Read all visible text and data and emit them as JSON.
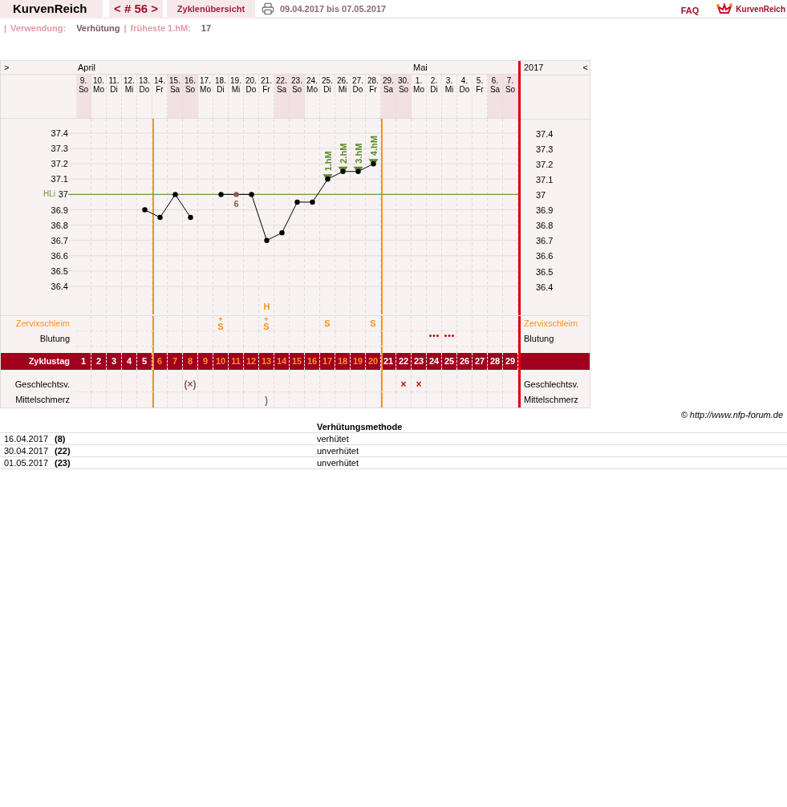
{
  "header": {
    "title": "KurvenReich",
    "cycle_nav": "< # 56 >",
    "overview_tab": "Zyklenübersicht",
    "period": "09.04.2017 bis 07.05.2017",
    "faq": "FAQ",
    "brand": "KurvenReich"
  },
  "info": {
    "sep1": "|",
    "usage_label": "Verwendung:",
    "usage_value": "Verhütung",
    "sep2": "|",
    "earliest_label": "früheste 1.hM:",
    "earliest_value": "17"
  },
  "chart": {
    "nav_left": ">",
    "year": "2017",
    "nav_right": "<",
    "row_labels": {
      "mucus": "Zervixschleim",
      "bleeding": "Blutung",
      "cycle": "Zyklustag",
      "intercourse": "Geschlechtsv.",
      "pain": "Mittelschmerz"
    },
    "right_labels": {
      "mucus": "Zervixschleim",
      "bleeding": "Blutung",
      "intercourse": "Geschlechtsv.",
      "pain": "Mittelschmerz"
    },
    "right_axis_labels": [
      "37.4",
      "37.3",
      "37.2",
      "37.1",
      "37",
      "36.9",
      "36.8",
      "36.7",
      "36.6",
      "36.5",
      "36.4"
    ],
    "days": [
      {
        "weekday": "So",
        "month": "April",
        "weekend": true,
        "fertile": false,
        "cycle_day": "1"
      },
      {
        "weekday": "Mo",
        "weekend": false,
        "fertile": false,
        "cycle_day": "2"
      },
      {
        "weekday": "Di",
        "weekend": false,
        "fertile": false,
        "cycle_day": "3"
      },
      {
        "weekday": "Mi",
        "weekend": false,
        "fertile": false,
        "cycle_day": "4"
      },
      {
        "weekday": "Do",
        "weekend": false,
        "fertile": false,
        "cycle_day": "5"
      },
      {
        "weekday": "Fr",
        "weekend": false,
        "fertile": true,
        "cycle_day": "6"
      },
      {
        "weekday": "Sa",
        "weekend": true,
        "fertile": true,
        "cycle_day": "7"
      },
      {
        "weekday": "So",
        "weekend": true,
        "fertile": true,
        "cycle_day": "8",
        "intercourse": {
          "text": "(×)",
          "protected": true
        }
      },
      {
        "weekday": "Mo",
        "weekend": false,
        "fertile": true,
        "cycle_day": "9"
      },
      {
        "weekday": "Di",
        "weekend": false,
        "fertile": true,
        "cycle_day": "10",
        "mucus": {
          "text": "S",
          "mark": "+"
        }
      },
      {
        "weekday": "Mi",
        "weekend": false,
        "fertile": true,
        "cycle_day": "11",
        "excluded_label": "6"
      },
      {
        "weekday": "Do",
        "weekend": false,
        "fertile": true,
        "cycle_day": "12"
      },
      {
        "weekday": "Fr",
        "weekend": false,
        "fertile": true,
        "cycle_day": "13",
        "mucus": {
          "text": "S",
          "mark": "+"
        },
        "pain": ")",
        "note": "H"
      },
      {
        "weekday": "Sa",
        "weekend": true,
        "fertile": true,
        "cycle_day": "14"
      },
      {
        "weekday": "So",
        "weekend": true,
        "fertile": true,
        "cycle_day": "15"
      },
      {
        "weekday": "Mo",
        "weekend": false,
        "fertile": true,
        "cycle_day": "16"
      },
      {
        "weekday": "Di",
        "weekend": false,
        "fertile": true,
        "cycle_day": "17",
        "mucus": {
          "text": "S"
        },
        "hm_label": "1.hM"
      },
      {
        "weekday": "Mi",
        "weekend": false,
        "fertile": true,
        "cycle_day": "18",
        "hm_label": "2.hM"
      },
      {
        "weekday": "Do",
        "weekend": false,
        "fertile": true,
        "cycle_day": "19",
        "hm_label": "3.hM"
      },
      {
        "weekday": "Fr",
        "weekend": false,
        "fertile": true,
        "cycle_day": "20",
        "mucus": {
          "text": "S"
        },
        "hm_label": "4.hM"
      },
      {
        "weekday": "Sa",
        "weekend": true,
        "fertile": false,
        "cycle_day": "21"
      },
      {
        "weekday": "So",
        "weekend": true,
        "fertile": false,
        "cycle_day": "22",
        "intercourse": {
          "text": "×",
          "protected": false
        }
      },
      {
        "weekday": "Mo",
        "month": "Mai",
        "weekend": false,
        "fertile": false,
        "cycle_day": "23",
        "intercourse": {
          "text": "×",
          "protected": false
        }
      },
      {
        "weekday": "Di",
        "weekend": false,
        "fertile": false,
        "cycle_day": "24",
        "bleeding": true
      },
      {
        "weekday": "Mi",
        "weekend": false,
        "fertile": false,
        "cycle_day": "25",
        "bleeding": true
      },
      {
        "weekday": "Do",
        "weekend": false,
        "fertile": false,
        "cycle_day": "26"
      },
      {
        "weekday": "Fr",
        "weekend": false,
        "fertile": false,
        "cycle_day": "27"
      },
      {
        "weekday": "Sa",
        "weekend": true,
        "fertile": false,
        "cycle_day": "28"
      },
      {
        "weekday": "So",
        "weekend": true,
        "fertile": false,
        "cycle_day": "29"
      }
    ],
    "chart_data": {
      "type": "line",
      "grid": true,
      "categories": [
        "9.",
        "10.",
        "11.",
        "12.",
        "13.",
        "14.",
        "15.",
        "16.",
        "17.",
        "18.",
        "19.",
        "20.",
        "21.",
        "22.",
        "23.",
        "24.",
        "25.",
        "26.",
        "27.",
        "28.",
        "29.",
        "30.",
        "1.",
        "2.",
        "3.",
        "4.",
        "5.",
        "6.",
        "7."
      ],
      "ylim": [
        36.4,
        37.4
      ],
      "yticks": [
        36.4,
        36.5,
        36.6,
        36.7,
        36.8,
        36.9,
        37,
        37.1,
        37.2,
        37.3,
        37.4
      ],
      "series": [
        {
          "color": "#000000",
          "marker": "o",
          "values": [
            null,
            null,
            null,
            null,
            36.9,
            36.85,
            37.0,
            36.85,
            null,
            37.0,
            37.0,
            37.0,
            36.7,
            36.75,
            36.95,
            36.95,
            37.1,
            37.15,
            37.15,
            37.2,
            null,
            null,
            null,
            null,
            null,
            null,
            null,
            null,
            null
          ]
        }
      ],
      "ref_lines": [
        {
          "axis": "y",
          "value": 37,
          "label": "HLi",
          "color": "#6a9a3a"
        }
      ]
    }
  },
  "copyright": "© http://www.nfp-forum.de",
  "methods": {
    "heading": "Verhütungsmethode",
    "rows": [
      {
        "date": "16.04.2017",
        "cycle_day": "(8)",
        "method": "verhütet"
      },
      {
        "date": "30.04.2017",
        "cycle_day": "(22)",
        "method": "unverhütet"
      },
      {
        "date": "01.05.2017",
        "cycle_day": "(23)",
        "method": "unverhütet"
      }
    ]
  }
}
